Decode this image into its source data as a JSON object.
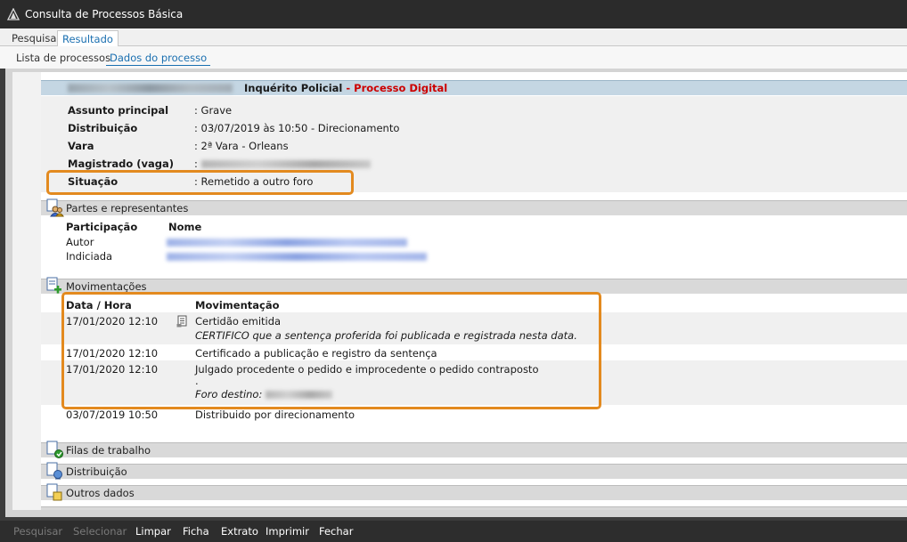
{
  "window": {
    "title": "Consulta de Processos Básica"
  },
  "tabs_top": [
    {
      "label": "Pesquisa",
      "active": false
    },
    {
      "label": "Resultado",
      "active": true
    }
  ],
  "tabs_sub": [
    {
      "label": "Lista de processos",
      "active": false
    },
    {
      "label": "Dados do processo",
      "active": true
    }
  ],
  "process": {
    "class_label": "Inquérito Policial",
    "separator": " - ",
    "type_label": "Processo Digital",
    "fields": [
      {
        "label": "Assunto principal",
        "value": ": Grave"
      },
      {
        "label": "Distribuição",
        "value": ": 03/07/2019 às 10:50 - Direcionamento"
      },
      {
        "label": "Vara",
        "value": ": 2ª Vara - Orleans"
      },
      {
        "label": "Magistrado (vaga)",
        "value": ":"
      },
      {
        "label": "Situação",
        "value": ": Remetido a outro foro"
      }
    ]
  },
  "sections": {
    "partes": "Partes e representantes",
    "movimentacoes": "Movimentações",
    "filas": "Filas de trabalho",
    "distribuicao": "Distribuição",
    "outros": "Outros dados"
  },
  "partes": {
    "headers": {
      "participacao": "Participação",
      "nome": "Nome"
    },
    "rows": [
      {
        "participacao": "Autor"
      },
      {
        "participacao": "Indiciada"
      }
    ]
  },
  "movimentacoes": {
    "headers": {
      "data": "Data / Hora",
      "mov": "Movimentação"
    },
    "rows": [
      {
        "data": "17/01/2020 12:10",
        "line1": "Certidão emitida",
        "line2": "CERTIFICO que a sentença proferida foi publicada e registrada nesta data."
      },
      {
        "data": "17/01/2020 12:10",
        "line1": "Certificado a publicação e registro da sentença"
      },
      {
        "data": "17/01/2020 12:10",
        "line1": "Julgado procedente o pedido e improcedente o pedido contraposto",
        "line2": ".",
        "line3": "Foro destino:"
      },
      {
        "data": "03/07/2019 10:50",
        "line1": "Distribuido por direcionamento"
      }
    ]
  },
  "bottom_buttons": {
    "pesquisar": "Pesquisar",
    "selecionar": "Selecionar",
    "limpar": "Limpar",
    "ficha": "Ficha",
    "extrato": "Extrato",
    "imprimir": "Imprimir",
    "fechar": "Fechar"
  },
  "colors": {
    "highlight": "#e38a1f",
    "link_blue": "#1a6fb0",
    "digital_red": "#cc0000",
    "header_blue": "#c4d6e3"
  }
}
